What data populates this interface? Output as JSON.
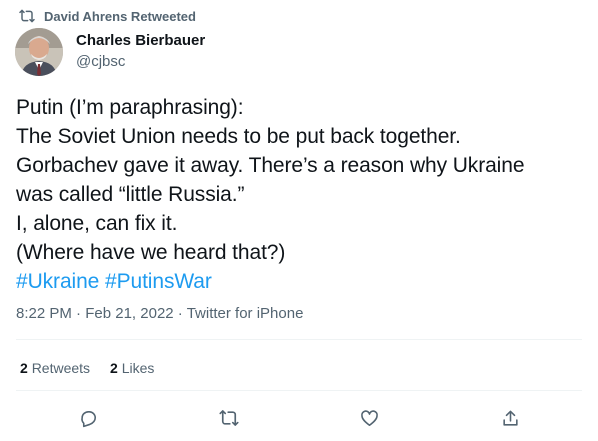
{
  "retweet_banner": {
    "label": "David Ahrens Retweeted",
    "icon": "retweet-icon"
  },
  "author": {
    "name": "Charles Bierbauer",
    "handle": "@cjbsc",
    "avatar_icon": "user-avatar"
  },
  "tweet": {
    "lines": [
      "Putin (I’m paraphrasing):",
      "The Soviet Union needs to be put back together.",
      "Gorbachev gave it away.  There’s a reason why Ukraine",
      "was called “little Russia.”",
      "I, alone, can fix it.",
      "(Where have we heard that?)"
    ],
    "hashtags": [
      "#Ukraine",
      "#PutinsWar"
    ],
    "hashtag_color": "#1d9bf0"
  },
  "meta": {
    "time": "8:22 PM",
    "date": "Feb 21, 2022",
    "source": "Twitter for iPhone",
    "separator": "·"
  },
  "stats": {
    "retweets_count": "2",
    "retweets_label": "Retweets",
    "likes_count": "2",
    "likes_label": "Likes"
  },
  "actions": [
    {
      "name": "reply",
      "icon": "reply-icon"
    },
    {
      "name": "retweet",
      "icon": "retweet-icon"
    },
    {
      "name": "like",
      "icon": "heart-icon"
    },
    {
      "name": "share",
      "icon": "share-icon"
    }
  ],
  "colors": {
    "text_primary": "#0f1419",
    "text_secondary": "#536471",
    "link": "#1d9bf0",
    "divider": "#eff3f4"
  }
}
